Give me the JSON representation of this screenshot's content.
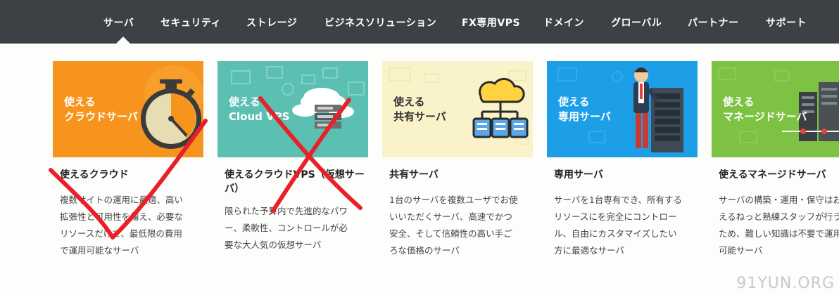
{
  "nav": {
    "items": [
      {
        "label": "サーバ",
        "active": true
      },
      {
        "label": "セキュリティ"
      },
      {
        "label": "ストレージ"
      },
      {
        "label": "ビジネスソリューション"
      },
      {
        "label": "FX専用VPS"
      },
      {
        "label": "ドメイン"
      },
      {
        "label": "グローバル"
      },
      {
        "label": "パートナー"
      },
      {
        "label": "サポート"
      }
    ]
  },
  "cards": [
    {
      "thumb_lines": [
        "使える",
        "クラウドサーバ"
      ],
      "thumb_color": "#f7941d",
      "icon": "stopwatch-icon",
      "title": "使えるクラウド",
      "desc": [
        "複数サイトの運用に最適、高い",
        "拡張性と可用性を備え、必要な",
        "リソースだけで、最低限の費用",
        "で運用可能なサーバ"
      ]
    },
    {
      "thumb_lines": [
        "使える",
        "Cloud VPS"
      ],
      "thumb_color": "#5bbfb2",
      "icon": "cloud-server-icon",
      "title": "使えるクラウドVPS（仮想サーバ）",
      "desc": [
        "限られた予算内で先進的なパワ",
        "ー、柔軟性、コントロールが必",
        "要な大人気の仮想サーバ"
      ]
    },
    {
      "thumb_lines": [
        "使える",
        "共有サーバ"
      ],
      "thumb_color": "#faf2c8",
      "icon": "cloud-network-icon",
      "title": "共有サーバ",
      "desc": [
        "1台のサーバを複数ユーザでお使",
        "いいただくサーバ、高速でかつ",
        "安全、そして信頼性の高い手ご",
        "ろな価格のサーバ"
      ]
    },
    {
      "thumb_lines": [
        "使える",
        "専用サーバ"
      ],
      "thumb_color": "#1c9fe6",
      "icon": "businessman-server-icon",
      "title": "専用サーバ",
      "desc": [
        "サーバを1台専有でき、所有する",
        "リソースにを完全にコントロー",
        "ル、自由にカスタマイズしたい",
        "方に最適なサーバ"
      ]
    },
    {
      "thumb_lines": [
        "使える",
        "マネージドサーバ"
      ],
      "thumb_color": "#7dc242",
      "icon": "server-rack-icon",
      "title": "使えるマネージドサーバ",
      "desc": [
        "サーバの構築・運用・保守はお使",
        "えるねっと熟練スタッフが行う",
        "ため、難しい知識は不要で運用",
        "可能サーバ"
      ]
    }
  ],
  "annotations": {
    "stroke_color": "#e8202a"
  },
  "watermark": "91YUN.ORG"
}
